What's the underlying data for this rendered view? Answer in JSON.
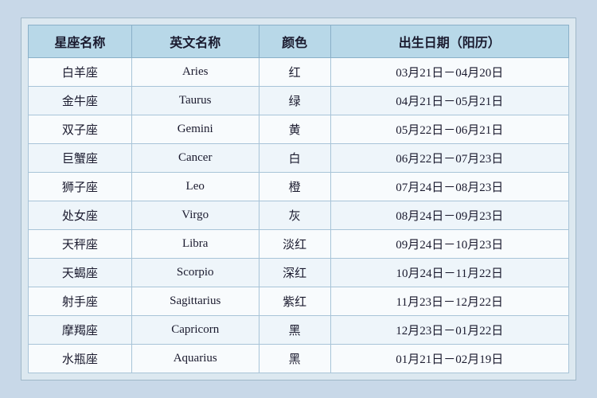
{
  "table": {
    "headers": [
      "星座名称",
      "英文名称",
      "颜色",
      "出生日期（阳历）"
    ],
    "rows": [
      {
        "cn": "白羊座",
        "en": "Aries",
        "color": "红",
        "date": "03月21日－04月20日"
      },
      {
        "cn": "金牛座",
        "en": "Taurus",
        "color": "绿",
        "date": "04月21日－05月21日"
      },
      {
        "cn": "双子座",
        "en": "Gemini",
        "color": "黄",
        "date": "05月22日－06月21日"
      },
      {
        "cn": "巨蟹座",
        "en": "Cancer",
        "color": "白",
        "date": "06月22日－07月23日"
      },
      {
        "cn": "狮子座",
        "en": "Leo",
        "color": "橙",
        "date": "07月24日－08月23日"
      },
      {
        "cn": "处女座",
        "en": "Virgo",
        "color": "灰",
        "date": "08月24日－09月23日"
      },
      {
        "cn": "天秤座",
        "en": "Libra",
        "color": "淡红",
        "date": "09月24日－10月23日"
      },
      {
        "cn": "天蝎座",
        "en": "Scorpio",
        "color": "深红",
        "date": "10月24日－11月22日"
      },
      {
        "cn": "射手座",
        "en": "Sagittarius",
        "color": "紫红",
        "date": "11月23日－12月22日"
      },
      {
        "cn": "摩羯座",
        "en": "Capricorn",
        "color": "黑",
        "date": "12月23日－01月22日"
      },
      {
        "cn": "水瓶座",
        "en": "Aquarius",
        "color": "黑",
        "date": "01月21日－02月19日"
      }
    ]
  }
}
